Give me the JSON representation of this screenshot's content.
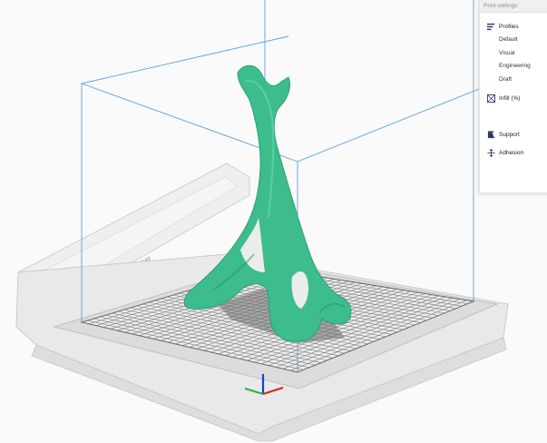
{
  "viewport": {
    "printer_brand": "Ultimaker",
    "colors": {
      "model": "#3dbd8c",
      "build_volume": "#5a9fe0",
      "bed": "#e6e6e6",
      "grid": "#7d7d7d"
    }
  },
  "print_settings": {
    "title": "Print settings",
    "profiles_label": "Profiles",
    "profiles": [
      "Default",
      "Visual",
      "Engineering",
      "Draft"
    ],
    "infill_label": "Infill (%)",
    "support_label": "Support",
    "adhesion_label": "Adhesion"
  }
}
